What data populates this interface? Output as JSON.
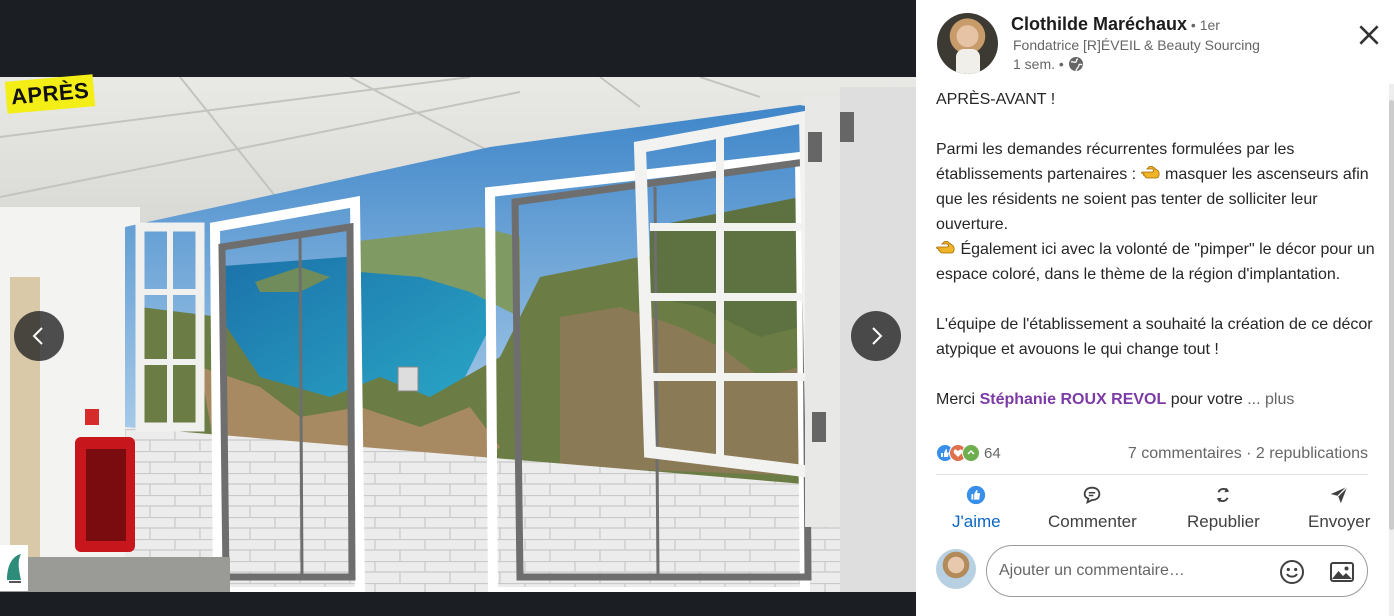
{
  "media": {
    "overlay_label": "APRÈS",
    "prev_icon": "chevron-left-icon",
    "next_icon": "chevron-right-icon"
  },
  "post": {
    "author": {
      "name": "Clothilde Maréchaux",
      "degree": " • 1er",
      "headline": "Fondatrice [R]ÉVEIL & Beauty Sourcing",
      "time": "1 sem. •"
    },
    "text": {
      "line1": "APRÈS-AVANT !",
      "p2_a": "Parmi les demandes récurrentes formulées par les établissements partenaires : ",
      "p2_b": " masquer les ascenseurs afin que les résidents ne soient pas tenter de solliciter leur ouverture.",
      "p3": " Également ici avec la volonté de \"pimper\" le décor pour un espace coloré, dans le thème de la région d'implantation.",
      "p4": "L'équipe de l'établissement a souhaité la création de ce décor atypique et avouons le qui change tout !",
      "p5_a": "Merci ",
      "mention": "Stéphanie ROUX REVOL",
      "p5_b": " pour votre ",
      "more": " ... plus"
    },
    "social": {
      "reaction_count": "64",
      "comments_reposts": "7 commentaires · 2 republications"
    },
    "actions": {
      "like": "J'aime",
      "comment": "Commenter",
      "repost": "Republier",
      "send": "Envoyer"
    },
    "comment": {
      "placeholder": "Ajouter un commentaire…"
    }
  },
  "colors": {
    "accent": "#0a66c2",
    "mention": "#7c3aa6",
    "viewer_bg": "#1b1f23",
    "tag_yellow": "#f4ee17"
  }
}
